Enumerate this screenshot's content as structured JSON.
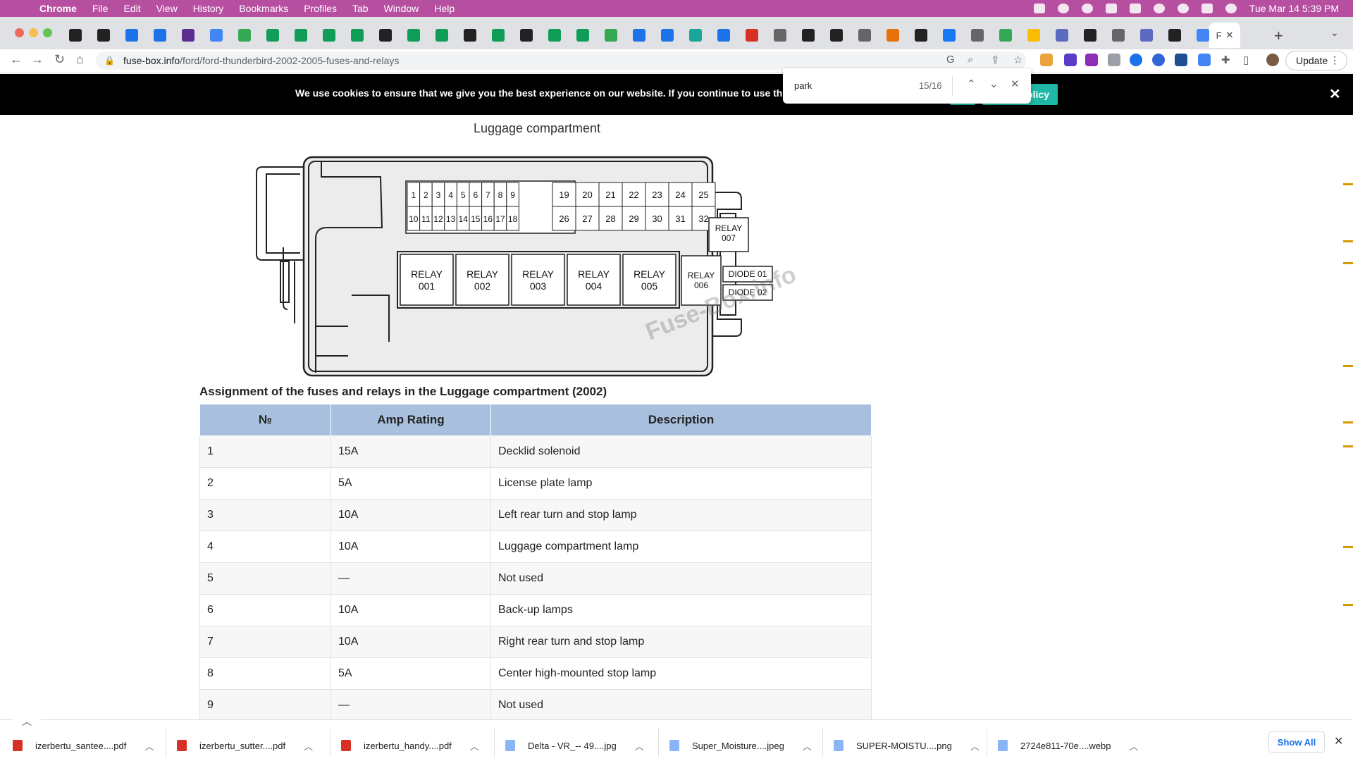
{
  "menubar": {
    "app": "Chrome",
    "items": [
      "File",
      "Edit",
      "View",
      "History",
      "Bookmarks",
      "Profiles",
      "Tab",
      "Window",
      "Help"
    ],
    "datetime": "Tue Mar 14  5:39 PM"
  },
  "tabs": {
    "active_label": "F"
  },
  "toolbar": {
    "url_host": "fuse-box.info",
    "url_path": "/ford/ford-thunderbird-2002-2005-fuses-and-relays",
    "update_label": "Update"
  },
  "cookie_banner": {
    "text": "We use cookies to ensure that we give you the best experience on our website. If you continue to use this site we w",
    "policy_label": "olicy"
  },
  "find_bar": {
    "query": "park",
    "count": "15/16"
  },
  "content": {
    "diagram_caption": "Luggage compartment",
    "table_caption": "Assignment of the fuses and relays in the Luggage compartment (2002)",
    "table_headers": [
      "№",
      "Amp Rating",
      "Description"
    ],
    "rows": [
      [
        "1",
        "15A",
        "Decklid solenoid"
      ],
      [
        "2",
        "5A",
        "License plate lamp"
      ],
      [
        "3",
        "10A",
        "Left rear turn and stop lamp"
      ],
      [
        "4",
        "10A",
        "Luggage compartment lamp"
      ],
      [
        "5",
        "—",
        "Not used"
      ],
      [
        "6",
        "10A",
        "Back-up lamps"
      ],
      [
        "7",
        "10A",
        "Right rear turn and stop lamp"
      ],
      [
        "8",
        "5A",
        "Center high-mounted stop lamp"
      ],
      [
        "9",
        "—",
        "Not used"
      ]
    ]
  },
  "diagram": {
    "fuses_top_left": [
      "1",
      "2",
      "3",
      "4",
      "5",
      "6",
      "7",
      "8",
      "9"
    ],
    "fuses_bottom_left": [
      "10",
      "11",
      "12",
      "13",
      "14",
      "15",
      "16",
      "17",
      "18"
    ],
    "fuses_top_right": [
      "19",
      "20",
      "21",
      "22",
      "23",
      "24",
      "25"
    ],
    "fuses_bottom_right": [
      "26",
      "27",
      "28",
      "29",
      "30",
      "31",
      "32"
    ],
    "relays": [
      {
        "line1": "RELAY",
        "line2": "001"
      },
      {
        "line1": "RELAY",
        "line2": "002"
      },
      {
        "line1": "RELAY",
        "line2": "003"
      },
      {
        "line1": "RELAY",
        "line2": "004"
      },
      {
        "line1": "RELAY",
        "line2": "005"
      }
    ],
    "relay006": {
      "line1": "RELAY",
      "line2": "006"
    },
    "relay007": {
      "line1": "RELAY",
      "line2": "007"
    },
    "diodes": [
      "DIODE 01",
      "DIODE 02"
    ],
    "watermark": "Fuse-Box.info"
  },
  "downloads": {
    "files": [
      {
        "name": "izerbertu_santee....pdf",
        "kind": "pdf"
      },
      {
        "name": "izerbertu_sutter....pdf",
        "kind": "pdf"
      },
      {
        "name": "izerbertu_handy....pdf",
        "kind": "pdf"
      },
      {
        "name": "Delta - VR_-- 49....jpg",
        "kind": "image"
      },
      {
        "name": "Super_Moisture....jpeg",
        "kind": "image"
      },
      {
        "name": "SUPER-MOISTU....png",
        "kind": "image"
      },
      {
        "name": "2724e811-70e....webp",
        "kind": "image"
      }
    ],
    "show_all_label": "Show All"
  },
  "colors": {
    "menubar": "#b64fa0",
    "cookie_button": "#1fb8a6",
    "table_header": "#a8c0de",
    "scroll_marker": "#d59a00"
  }
}
